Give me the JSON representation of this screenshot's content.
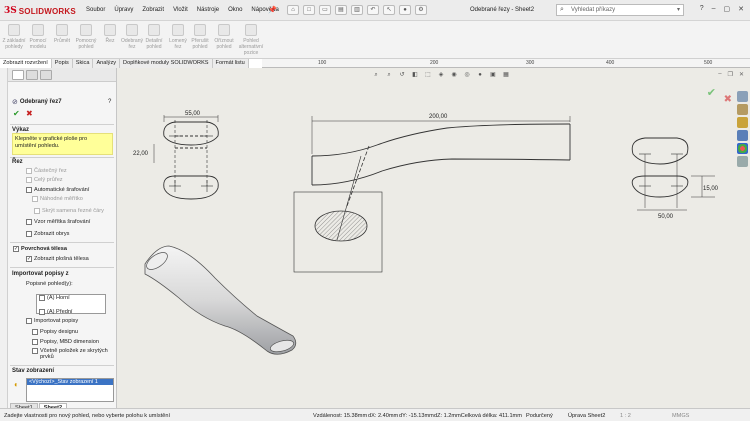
{
  "app": {
    "logo_ds": "3S",
    "logo_text": "SOLIDWORKS",
    "document_title": "Odebrané řezy - Sheet2"
  },
  "menu": [
    "Soubor",
    "Úpravy",
    "Zobrazit",
    "Vložit",
    "Nástroje",
    "Okno",
    "Nápověda"
  ],
  "search": {
    "placeholder": "Vyhledat příkazy"
  },
  "ribbon": [
    {
      "label": "Z základní pohledy"
    },
    {
      "label": "Pomocí modelu"
    },
    {
      "label": "Průmět"
    },
    {
      "label": "Pomocný pohled"
    },
    {
      "label": "Řez"
    },
    {
      "label": "Odebraný řez"
    },
    {
      "label": "Detailní pohled"
    },
    {
      "label": "Lomený řez"
    },
    {
      "label": "Přerušit pohled"
    },
    {
      "label": "Oříznout pohled"
    },
    {
      "label": "Pohled alternativní pozice"
    }
  ],
  "tabs": [
    "Zobrazit rozvržení",
    "Popis",
    "Skica",
    "Analýzy",
    "Doplňkové moduly SOLIDWORKS",
    "Formát listu"
  ],
  "ruler": [
    "200",
    "100",
    "200",
    "300",
    "400",
    "500"
  ],
  "panel": {
    "title": "Odebraný řez7",
    "ok": "✔",
    "cancel": "✖",
    "section_message": "Výkaz",
    "message": "Klepněte v grafické ploše pro umístění pohledu.",
    "rez_section": "Řez",
    "rez_opts": [
      {
        "label": "Částečný řez",
        "checked": false,
        "disabled": true
      },
      {
        "label": "Celý průřez",
        "checked": false,
        "disabled": true
      },
      {
        "label": "Automatické šrafování",
        "checked": false,
        "disabled": false
      },
      {
        "label": "Náhodné měřítko",
        "checked": false,
        "disabled": true
      },
      {
        "label": "Skrýt samena řezné čáry",
        "checked": false,
        "disabled": true
      },
      {
        "label": "Vzor měřítka šrafování",
        "checked": false,
        "disabled": false
      },
      {
        "label": "Zobrazit obrys",
        "checked": false,
        "disabled": false
      }
    ],
    "bodies_section": "Povrchová tělesa",
    "bodies_opt": "Zobrazit plošná tělesa",
    "import_section": "Importovat popisy z",
    "views_label": "Popisné pohled(y):",
    "views": [
      "(A) Horní",
      "(A) Přední"
    ],
    "import_opts": [
      "Importovat popisy",
      "Popisy designu",
      "Popisy, MBD dimension",
      "Včetně položek ze skrytých prvků"
    ],
    "state_section": "Stav zobrazení",
    "state_value": "<Výchozí>_Stav zobrazení 1"
  },
  "drawing": {
    "dims": [
      "55,00",
      "22,00",
      "200,00",
      "15,00",
      "50,00"
    ]
  },
  "sheets": [
    "Sheet1",
    "Sheet2"
  ],
  "status": {
    "hint": "Zadejte vlastnosti pro nový pohled, nebo vyberte polohu k umístění",
    "distance": "Vzdálenost: 15.38mm",
    "dx": "dX: 2.40mm",
    "dy": "dY: -15.13mm",
    "dz": "dZ: 1.2mmCelková délka: 411.1mm",
    "defined": "Podurčený",
    "editing": "Úprava Sheet2",
    "scale": "1 : 2",
    "units": "MMGS"
  }
}
